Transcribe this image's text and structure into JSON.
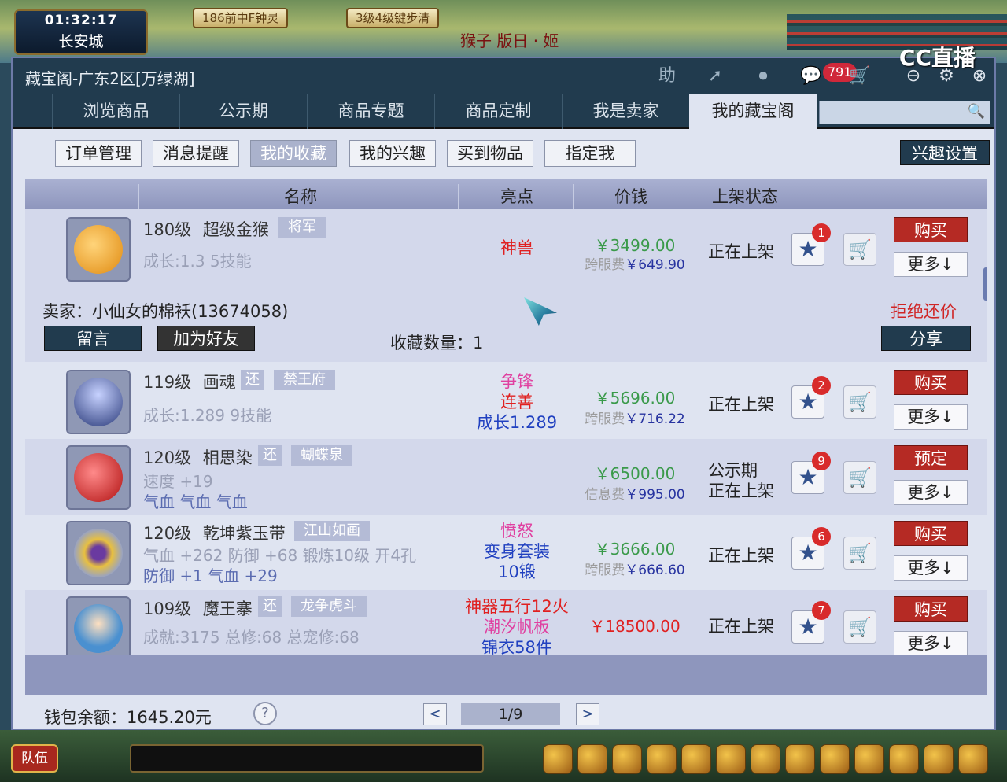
{
  "game": {
    "clock": "01:32:17",
    "city": "长安城",
    "top_buttons": [
      "186前中F钟灵",
      "3级4级键步清"
    ],
    "banner": "猴子 版日 · 姬",
    "watermark": "CC直播",
    "team_button": "队伍"
  },
  "window": {
    "title": "藏宝阁-广东2区[万绿湖]",
    "help_icon_label": "助",
    "cart_count": "791"
  },
  "nav": {
    "tabs": [
      "浏览商品",
      "公示期",
      "商品专题",
      "商品定制",
      "我是卖家",
      "我的藏宝阁"
    ],
    "active_index": 5,
    "search_placeholder": ""
  },
  "subnav": {
    "buttons": [
      "订单管理",
      "消息提醒",
      "我的收藏",
      "我的兴趣",
      "买到物品",
      "指定我"
    ],
    "active_index": 2,
    "interest_settings": "兴趣设置"
  },
  "table": {
    "headers": [
      "名称",
      "亮点",
      "价钱",
      "上架状态"
    ]
  },
  "items": [
    {
      "level_name": "180级",
      "name": "超级金猴",
      "tags": [
        "将军"
      ],
      "details": [
        "成长:1.3  5技能"
      ],
      "highlights": [
        {
          "text": "神兽",
          "color": "#e02020"
        }
      ],
      "price": "￥3499.00",
      "fee_label": "跨服费",
      "fee": "￥649.90",
      "status": [
        "正在上架"
      ],
      "fav_num": "1",
      "buy_label": "购买",
      "more_label": "更多↓",
      "seller": "卖家：小仙女的棉袄(13674058)",
      "message_btn": "留言",
      "add_friend_btn": "加为好友",
      "fav_count": "收藏数量：1",
      "reject_text": "拒绝还价",
      "share_btn": "分享",
      "pic_color": "#f0a020"
    },
    {
      "level_name": "119级",
      "name": "画魂",
      "tags": [
        "还",
        "禁王府"
      ],
      "details": [
        "成长:1.289  9技能"
      ],
      "highlights": [
        {
          "text": "争锋",
          "color": "#e040a0"
        },
        {
          "text": "连善",
          "color": "#e02020"
        },
        {
          "text": "成长1.289",
          "color": "#2040c0"
        }
      ],
      "price": "￥5696.00",
      "fee_label": "跨服费",
      "fee": "￥716.22",
      "status": [
        "正在上架"
      ],
      "fav_num": "2",
      "buy_label": "购买",
      "more_label": "更多↓",
      "pic_color": "#3a4a8a"
    },
    {
      "level_name": "120级",
      "name": "相思染",
      "tags": [
        "还",
        "蝴蝶泉"
      ],
      "details": [
        "速度 +19",
        "气血 气血 气血"
      ],
      "highlights": [],
      "price": "￥6500.00",
      "fee_label": "信息费",
      "fee": "￥995.00",
      "status": [
        "公示期",
        "正在上架"
      ],
      "fav_num": "9",
      "buy_label": "预定",
      "more_label": "更多↓",
      "pic_color": "#d02020"
    },
    {
      "level_name": "120级",
      "name": "乾坤紫玉带",
      "tags": [
        "江山如画"
      ],
      "details": [
        "气血 +262 防御 +68 锻炼10级 开4孔",
        "防御 +1 气血 +29"
      ],
      "highlights": [
        {
          "text": "愤怒",
          "color": "#e040a0"
        },
        {
          "text": "变身套装",
          "color": "#2040c0"
        },
        {
          "text": "10锻",
          "color": "#2040c0"
        }
      ],
      "price": "￥3666.00",
      "fee_label": "跨服费",
      "fee": "￥666.60",
      "status": [
        "正在上架"
      ],
      "fav_num": "6",
      "buy_label": "购买",
      "more_label": "更多↓",
      "pic_color": "#c8a020"
    },
    {
      "level_name": "109级",
      "name": "魔王寨",
      "tags": [
        "还",
        "龙争虎斗"
      ],
      "details": [
        "成就:3175  总修:68  总宠修:68"
      ],
      "highlights": [
        {
          "text": "神器五行12火",
          "color": "#e02020"
        },
        {
          "text": "潮汐帆板",
          "color": "#e040a0"
        },
        {
          "text": "锦衣58件",
          "color": "#2040c0"
        }
      ],
      "price": "￥18500.00",
      "price_color": "#e02020",
      "status": [
        "正在上架"
      ],
      "fav_num": "7",
      "buy_label": "购买",
      "more_label": "更多↓",
      "pic_color": "#4a90d0"
    }
  ],
  "footer": {
    "wallet": "钱包余额：1645.20元",
    "help": "?",
    "prev": "<",
    "page": "1/9",
    "next": ">"
  }
}
